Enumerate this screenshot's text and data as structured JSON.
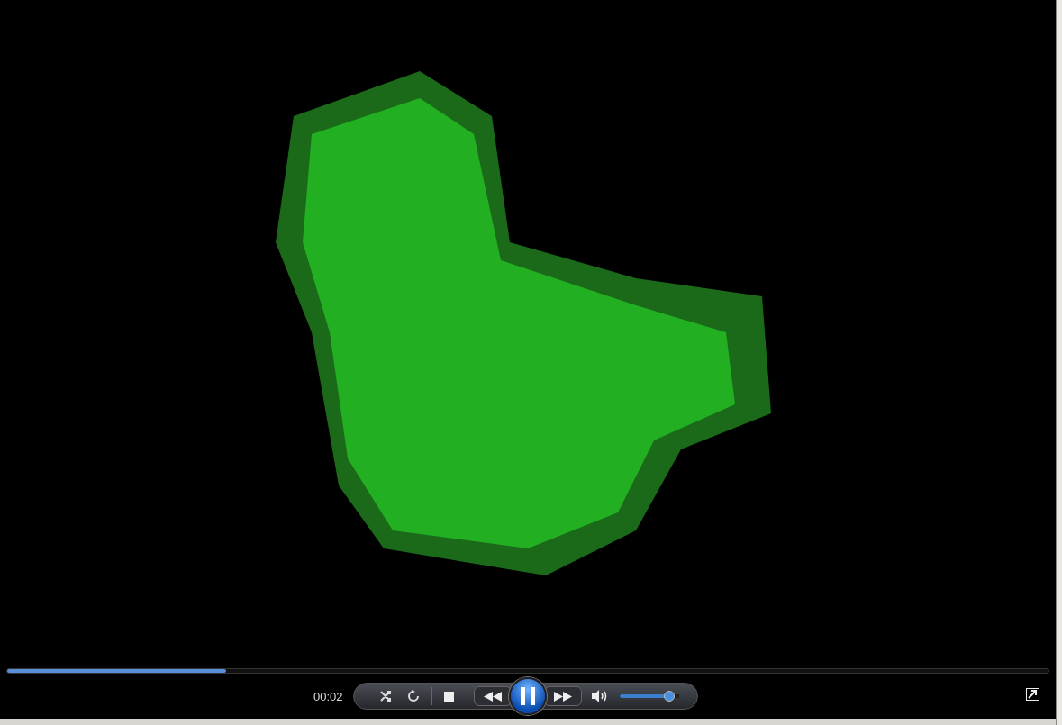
{
  "player": {
    "playing": true,
    "time": "00:02",
    "seek": {
      "level": 0.21
    },
    "volume": {
      "level": 0.83
    }
  }
}
